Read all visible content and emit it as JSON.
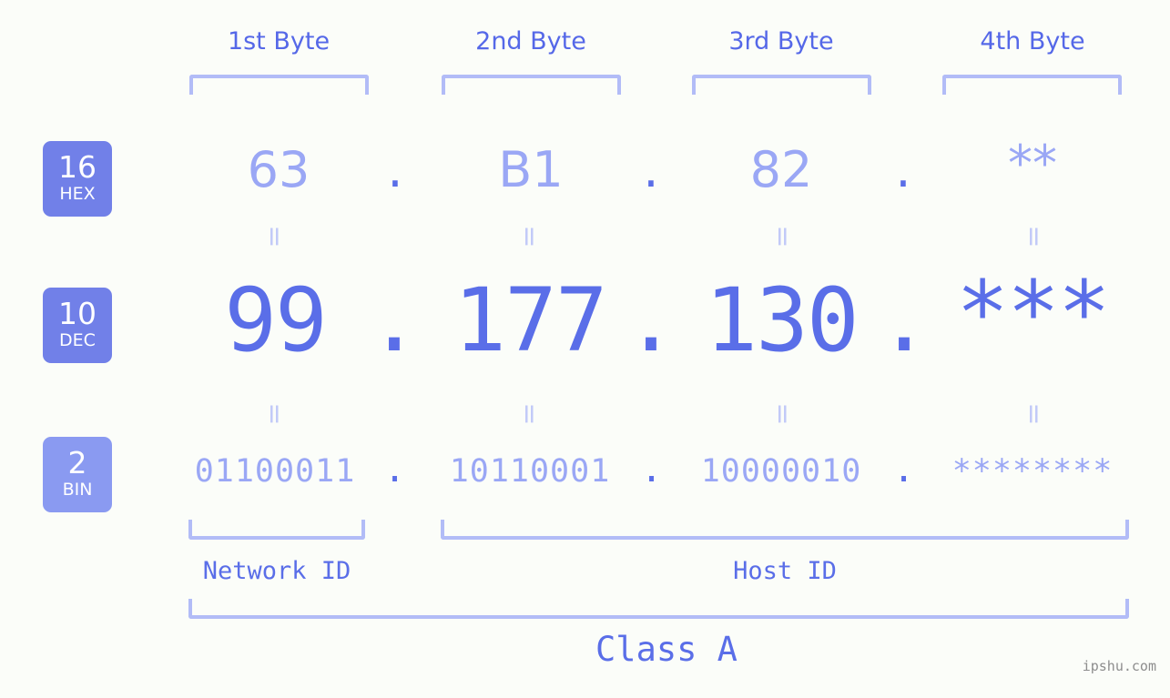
{
  "background_color": "#fbfdf9",
  "accent_color": "#5a6ee8",
  "light_accent_color": "#9aa7f5",
  "bracket_color": "#b2bcf7",
  "byte_headers": [
    {
      "label": "1st Byte"
    },
    {
      "label": "2nd Byte"
    },
    {
      "label": "3rd Byte"
    },
    {
      "label": "4th Byte"
    }
  ],
  "bases": [
    {
      "number": "16",
      "name": "HEX",
      "color": "#7180e8"
    },
    {
      "number": "10",
      "name": "DEC",
      "color": "#7180e8"
    },
    {
      "number": "2",
      "name": "BIN",
      "color": "#8a9af1"
    }
  ],
  "rows": {
    "hex": {
      "values": [
        "63",
        "B1",
        "82",
        "**"
      ],
      "separators": [
        ".",
        ".",
        "."
      ]
    },
    "dec": {
      "values": [
        "99",
        "177",
        "130",
        "***"
      ],
      "separators": [
        ".",
        ".",
        "."
      ]
    },
    "bin": {
      "values": [
        "01100011",
        "10110001",
        "10000010",
        "********"
      ],
      "separators": [
        ".",
        ".",
        "."
      ]
    }
  },
  "equals_marks": [
    "=",
    "=",
    "=",
    "=",
    "=",
    "=",
    "=",
    "="
  ],
  "segments": {
    "network_id": "Network ID",
    "host_id": "Host ID"
  },
  "class_label": "Class A",
  "watermark": "ipshu.com"
}
